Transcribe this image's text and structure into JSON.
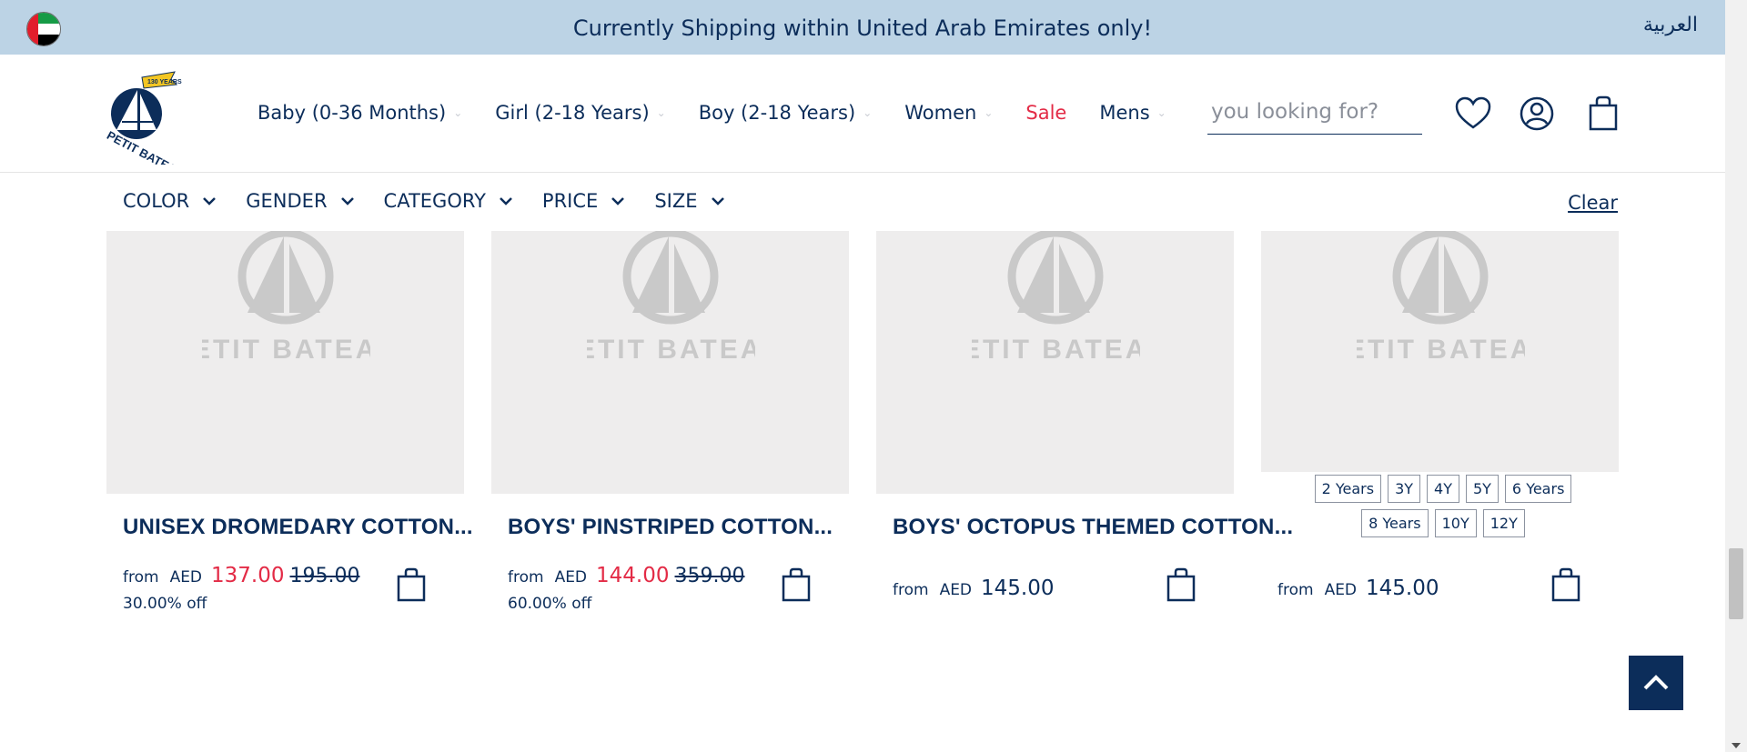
{
  "banner": {
    "text": "Currently Shipping within United Arab Emirates only!",
    "language": "العربية",
    "flag_icon": "uae-flag-icon"
  },
  "header": {
    "logo_text": "PETIT BATEAU",
    "logo_badge": "130 YEARS",
    "nav": [
      {
        "label": "Baby (0-36 Months)"
      },
      {
        "label": "Girl (2-18 Years)"
      },
      {
        "label": "Boy (2-18 Years)"
      },
      {
        "label": "Women"
      },
      {
        "label": "Sale"
      },
      {
        "label": "Mens"
      }
    ],
    "search": {
      "value": "",
      "placeholder": "you looking for?"
    },
    "icons": [
      "wishlist-heart-icon",
      "account-icon",
      "cart-bag-icon"
    ]
  },
  "filters": {
    "items": [
      {
        "label": "COLOR"
      },
      {
        "label": "GENDER"
      },
      {
        "label": "CATEGORY"
      },
      {
        "label": "PRICE"
      },
      {
        "label": "SIZE"
      }
    ],
    "clear_label": "Clear"
  },
  "products": [
    {
      "title": "UNISEX DROMEDARY COTTON...",
      "from": "from",
      "currency": "AED",
      "price": "137.00",
      "old_price": "195.00",
      "discount": "30.00% off"
    },
    {
      "title": "BOYS' PINSTRIPED COTTON...",
      "from": "from",
      "currency": "AED",
      "price": "144.00",
      "old_price": "359.00",
      "discount": "60.00% off"
    },
    {
      "title": "BOYS' OCTOPUS THEMED COTTON...",
      "from": "from",
      "currency": "AED",
      "price": "145.00"
    },
    {
      "sizes": [
        "2 Years",
        "3Y",
        "4Y",
        "5Y",
        "6 Years",
        "8 Years",
        "10Y",
        "12Y"
      ],
      "from": "from",
      "currency": "AED",
      "price": "145.00"
    }
  ],
  "colors": {
    "navy": "#0c2d5a",
    "sale_red": "#e32b46",
    "banner_bg": "#bcd3e5",
    "placeholder_bg": "#eeeded"
  }
}
